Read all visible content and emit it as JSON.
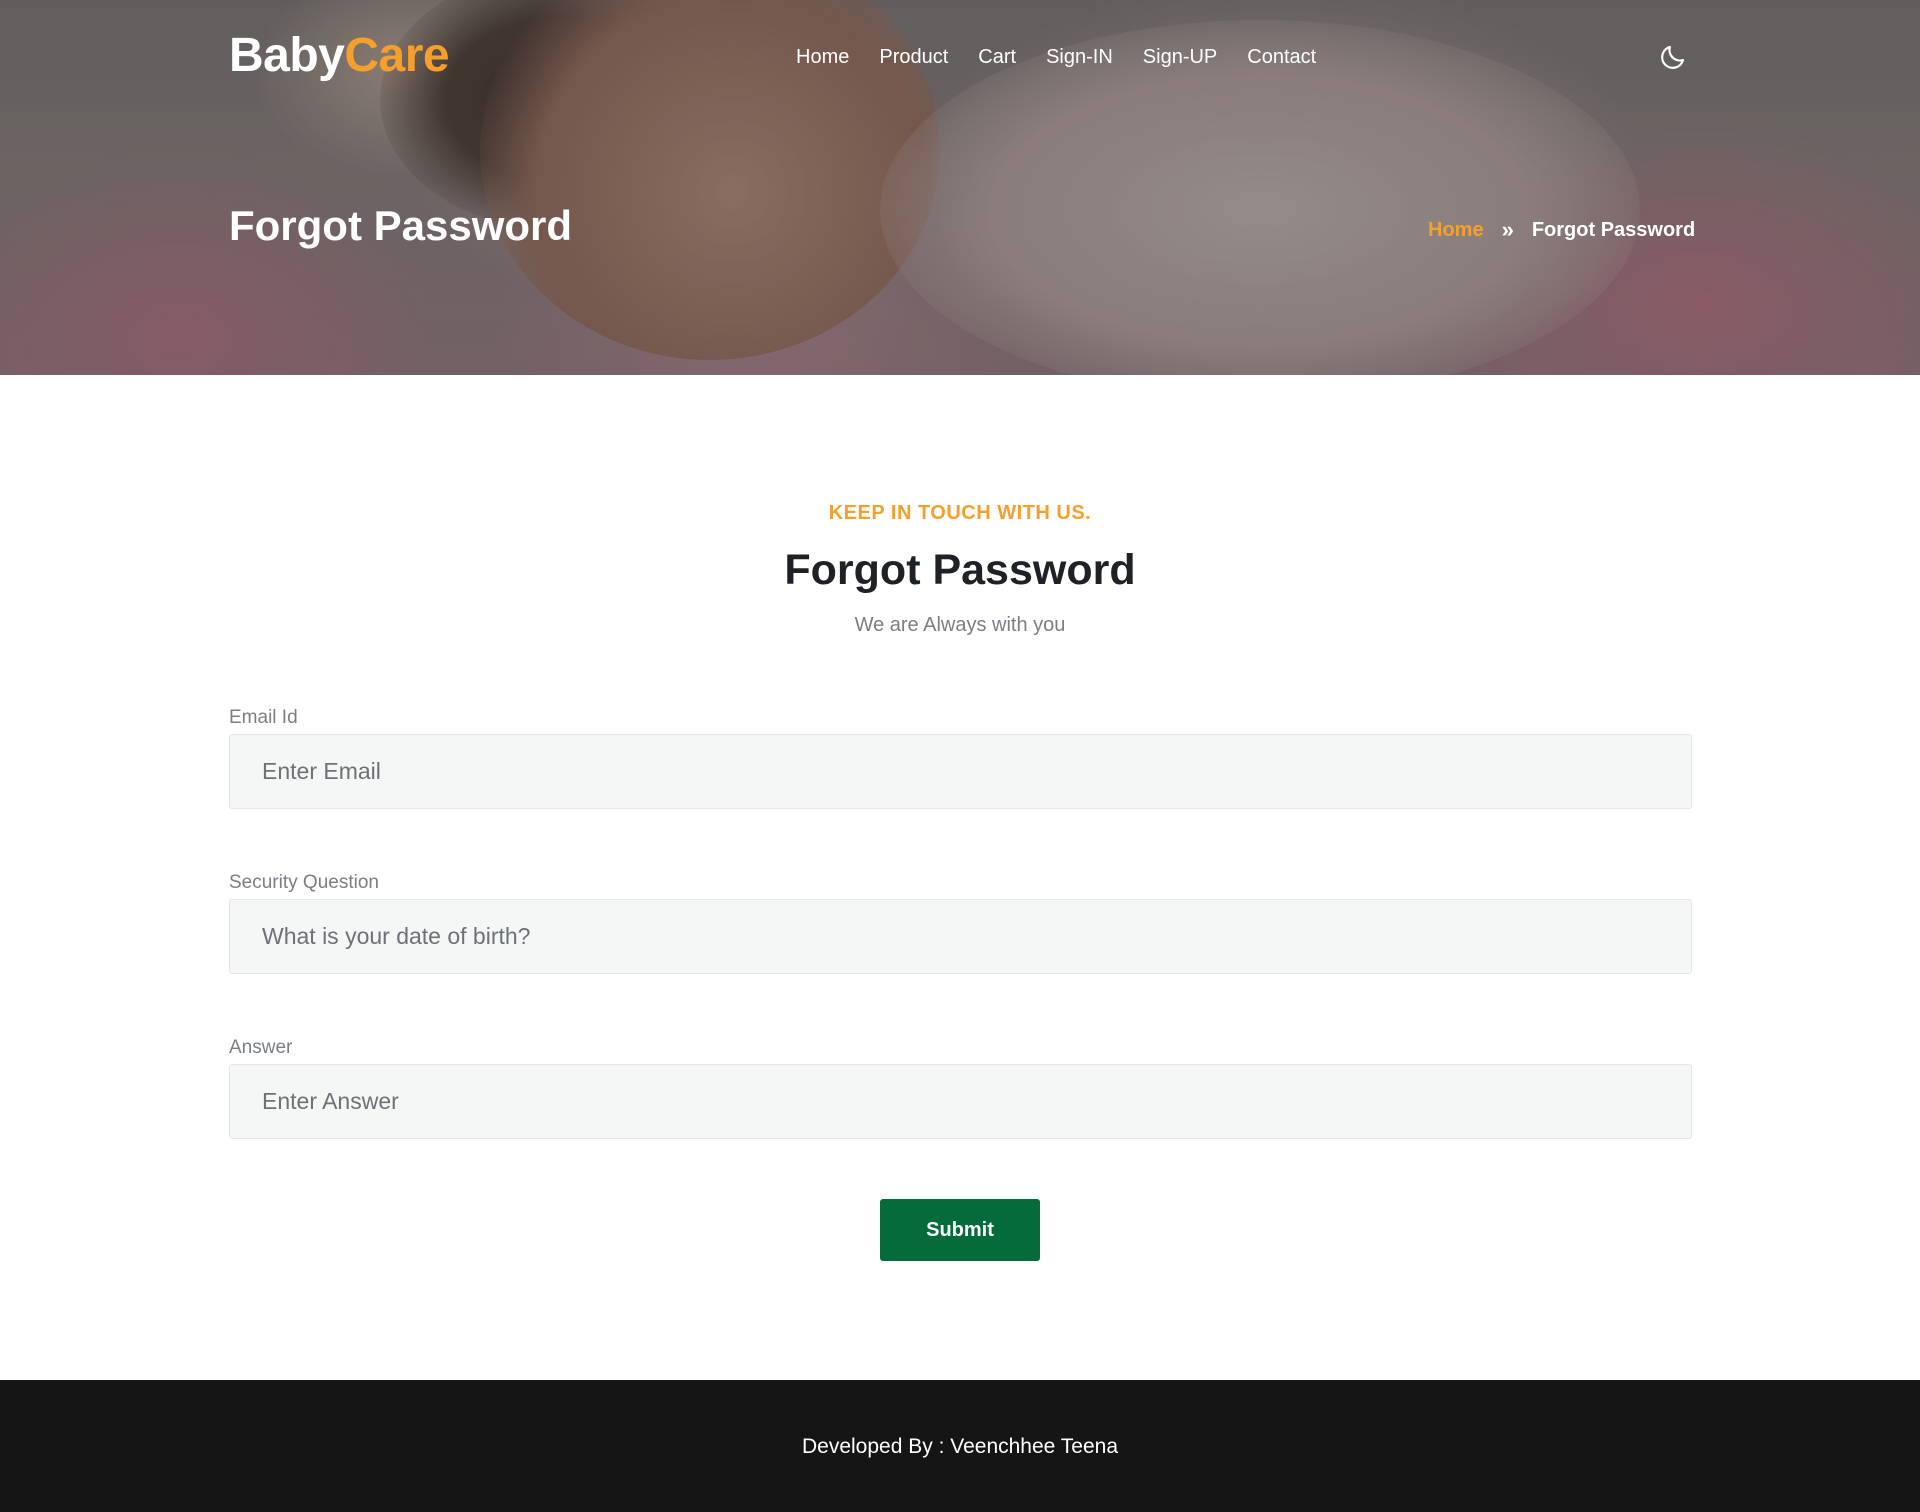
{
  "brand": {
    "part1": "Baby",
    "part2": "Care",
    "accent": "#f5a02c"
  },
  "nav": {
    "items": [
      {
        "label": "Home"
      },
      {
        "label": "Product"
      },
      {
        "label": "Cart"
      },
      {
        "label": "Sign-IN"
      },
      {
        "label": "Sign-UP"
      },
      {
        "label": "Contact"
      }
    ],
    "theme_toggle_icon": "moon-icon"
  },
  "hero": {
    "title": "Forgot Password",
    "breadcrumb": {
      "home": "Home",
      "separator": "»",
      "current": "Forgot Password"
    }
  },
  "section": {
    "eyebrow": "KEEP IN TOUCH WITH US.",
    "title": "Forgot Password",
    "subtitle": "We are Always with you"
  },
  "form": {
    "email": {
      "label": "Email Id",
      "placeholder": "Enter Email",
      "value": ""
    },
    "security_question": {
      "label": "Security Question",
      "placeholder": "What is your date of birth?",
      "value": ""
    },
    "answer": {
      "label": "Answer",
      "placeholder": "Enter Answer",
      "value": ""
    },
    "submit_label": "Submit",
    "submit_color": "#046b3b"
  },
  "footer": {
    "credit": "Developed By : Veenchhee Teena"
  }
}
